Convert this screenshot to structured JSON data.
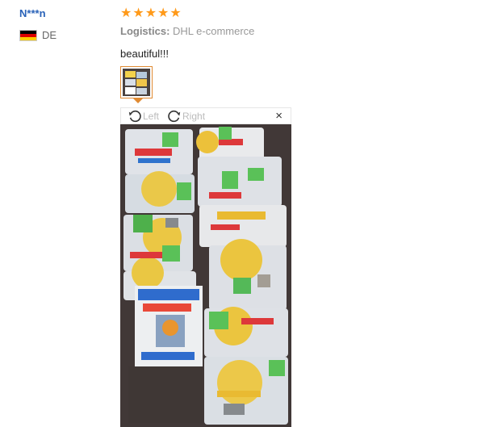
{
  "reviewer": {
    "name": "N***n",
    "country": "DE"
  },
  "review": {
    "stars": 5,
    "logistics_label": "Logistics:",
    "logistics_value": "DHL e-commerce",
    "text": "beautiful!!!"
  },
  "viewer": {
    "rotate_left": "Left",
    "rotate_right": "Right",
    "close": "×"
  },
  "colors": {
    "star": "#ff9a1a",
    "name": "#2962b8",
    "thumb_border": "#e08a32"
  }
}
